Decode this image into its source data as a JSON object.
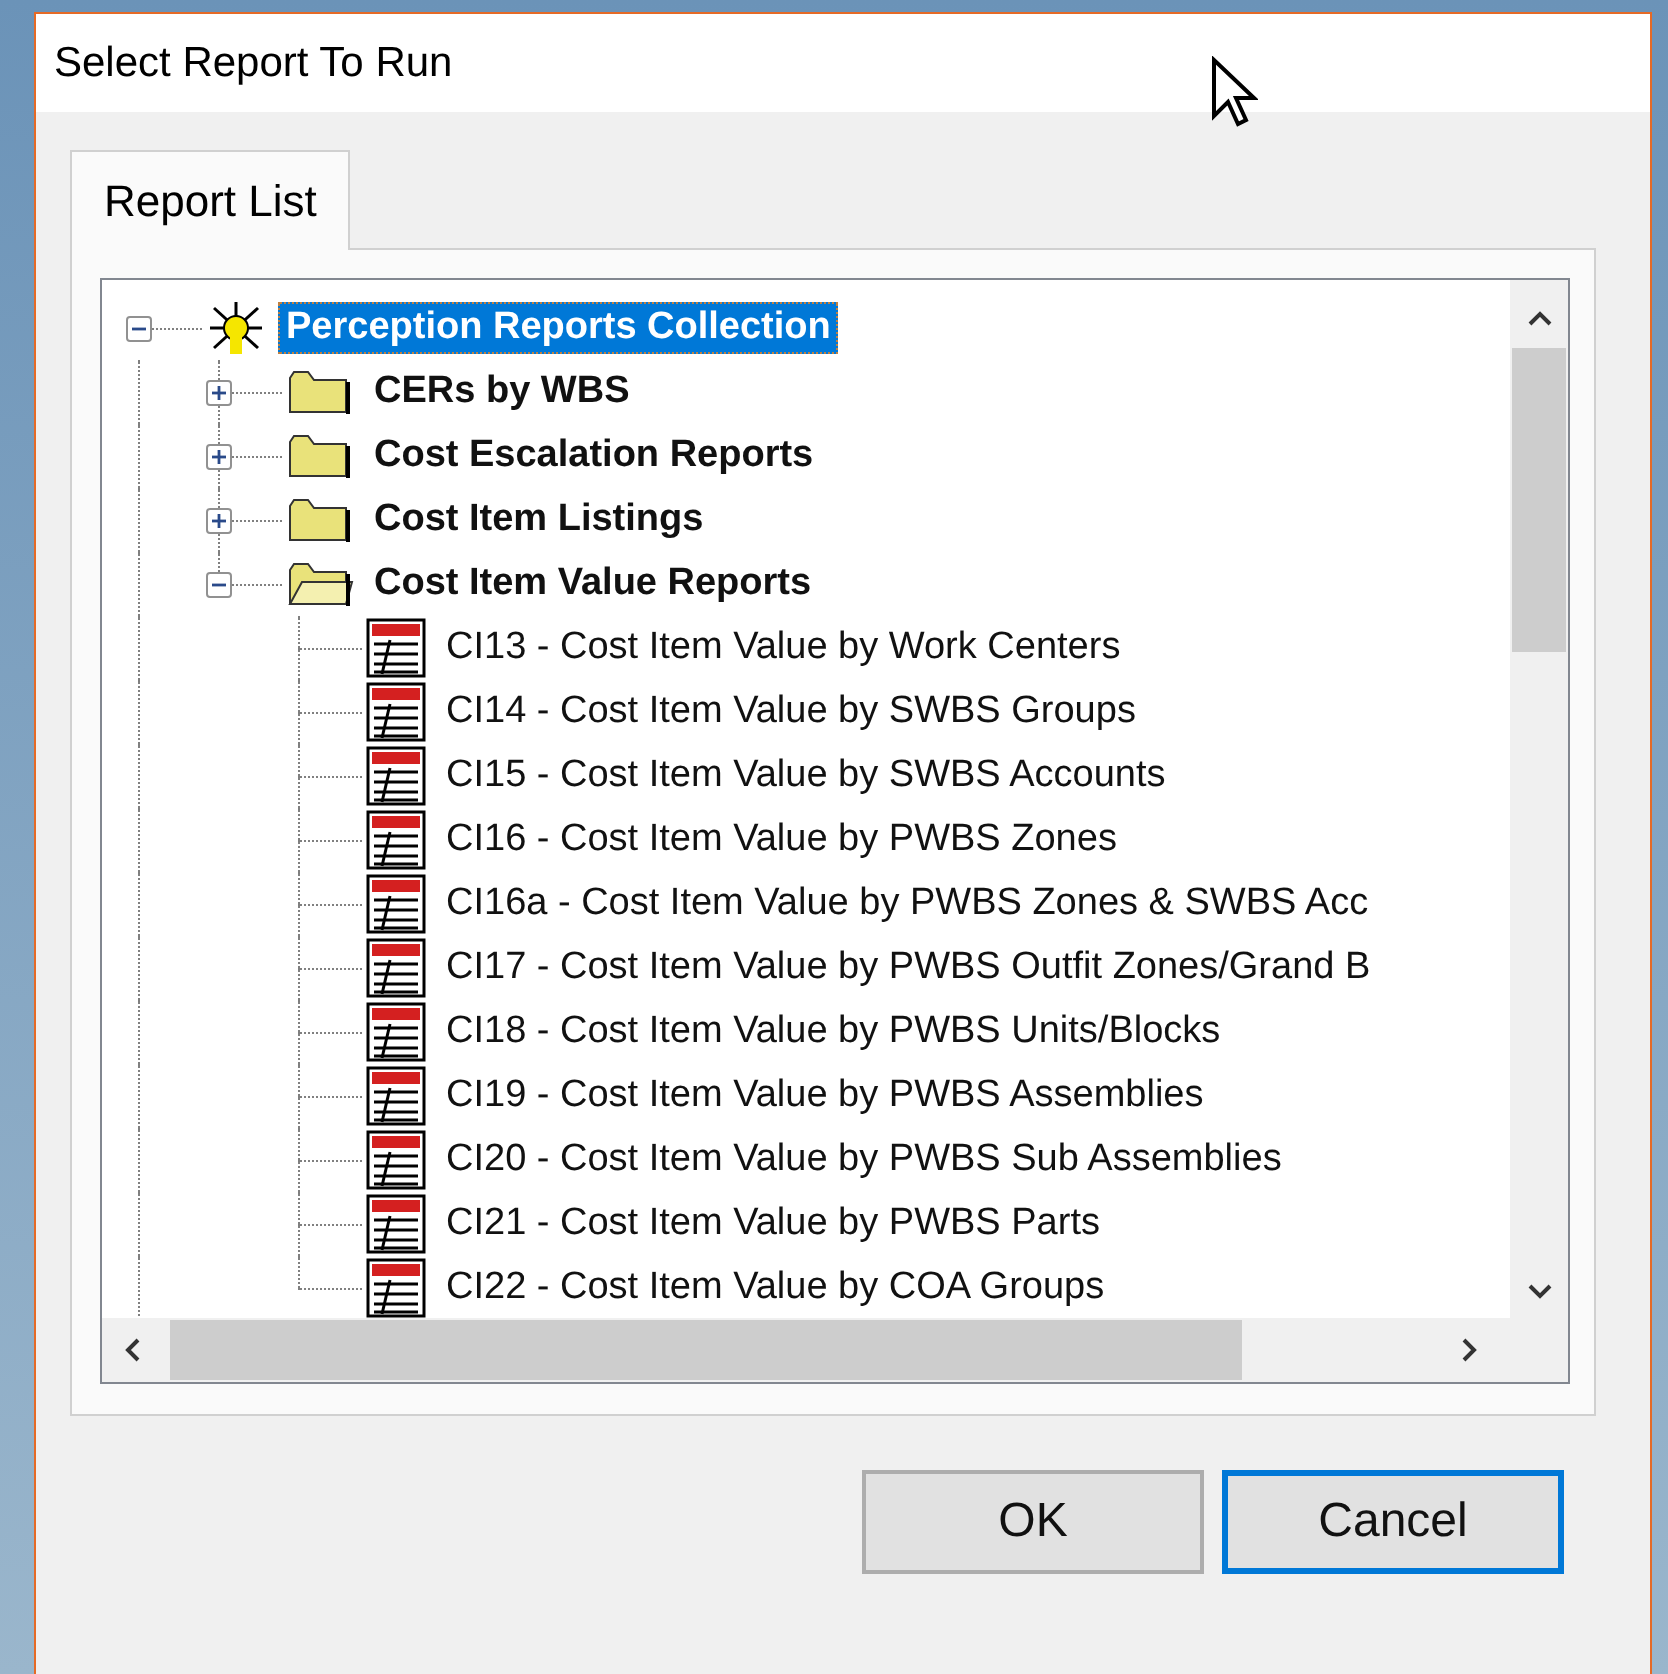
{
  "window": {
    "title": "Select Report To Run"
  },
  "tabs": [
    {
      "label": "Report List",
      "selected": true
    }
  ],
  "tree": [
    {
      "label": "Perception Reports Collection",
      "kind": "root",
      "expanded": true,
      "selected": true,
      "children": [
        {
          "label": "CERs by WBS",
          "kind": "folder",
          "expanded": false,
          "selected": false
        },
        {
          "label": "Cost Escalation Reports",
          "kind": "folder",
          "expanded": false,
          "selected": false
        },
        {
          "label": "Cost Item Listings",
          "kind": "folder",
          "expanded": false,
          "selected": false
        },
        {
          "label": "Cost Item Value Reports",
          "kind": "folder",
          "expanded": true,
          "selected": false,
          "children": [
            {
              "label": "CI13 - Cost Item Value by Work Centers",
              "kind": "report",
              "selected": false
            },
            {
              "label": "CI14 - Cost Item Value by SWBS Groups",
              "kind": "report",
              "selected": false
            },
            {
              "label": "CI15 - Cost Item Value by SWBS Accounts",
              "kind": "report",
              "selected": false
            },
            {
              "label": "CI16 - Cost Item Value by PWBS Zones",
              "kind": "report",
              "selected": false
            },
            {
              "label": "CI16a - Cost Item Value by PWBS Zones & SWBS Acc",
              "kind": "report",
              "selected": false
            },
            {
              "label": "CI17 - Cost Item Value by PWBS Outfit Zones/Grand B",
              "kind": "report",
              "selected": false
            },
            {
              "label": "CI18 - Cost Item Value by PWBS Units/Blocks",
              "kind": "report",
              "selected": false
            },
            {
              "label": "CI19 - Cost Item Value by PWBS Assemblies",
              "kind": "report",
              "selected": false
            },
            {
              "label": "CI20 - Cost Item Value by PWBS Sub Assemblies",
              "kind": "report",
              "selected": false
            },
            {
              "label": "CI21 - Cost Item Value by PWBS Parts",
              "kind": "report",
              "selected": false
            },
            {
              "label": "CI22 - Cost Item Value by COA Groups",
              "kind": "report",
              "selected": false
            }
          ]
        }
      ]
    }
  ],
  "buttons": [
    {
      "label": "OK",
      "kind": "normal"
    },
    {
      "label": "Cancel",
      "kind": "default"
    }
  ]
}
